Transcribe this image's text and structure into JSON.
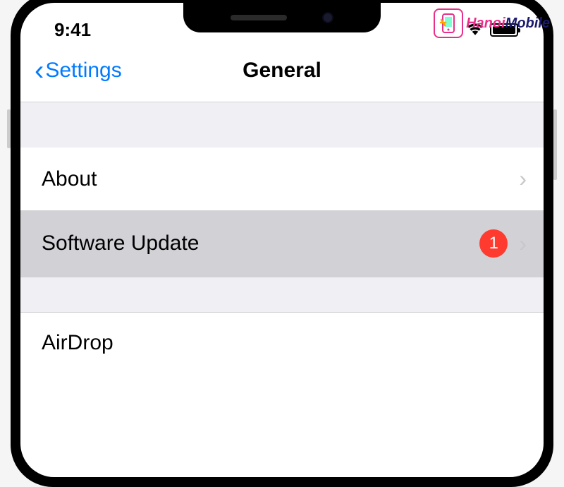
{
  "status_bar": {
    "time": "9:41"
  },
  "nav": {
    "back_label": "Settings",
    "title": "General"
  },
  "items": {
    "about": {
      "label": "About"
    },
    "software_update": {
      "label": "Software Update",
      "badge": "1"
    },
    "airdrop": {
      "label": "AirDrop"
    }
  },
  "watermark": {
    "part1": "Hanoi",
    "part2": "Mobile"
  }
}
